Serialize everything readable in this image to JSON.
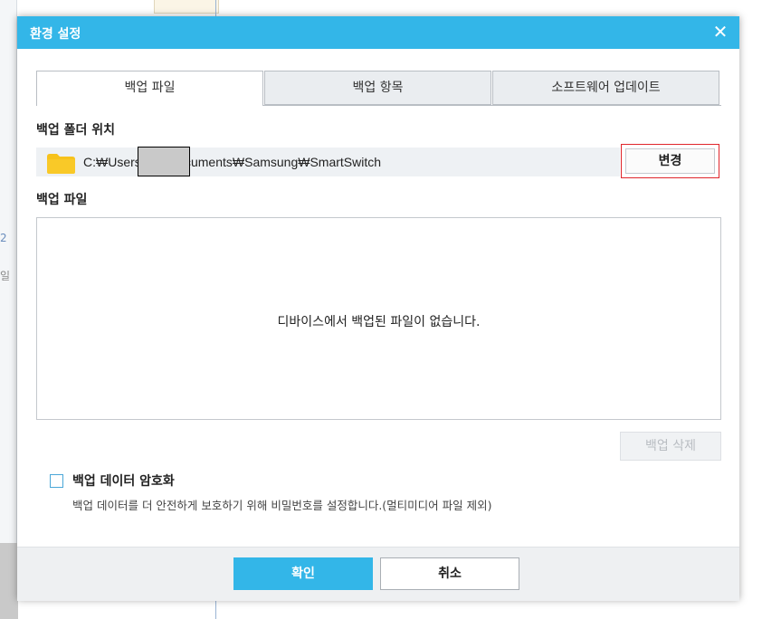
{
  "dialog": {
    "title": "환경 설정",
    "close_glyph": "✕"
  },
  "tabs": [
    {
      "label": "백업 파일",
      "active": true
    },
    {
      "label": "백업 항목",
      "active": false
    },
    {
      "label": "소프트웨어 업데이트",
      "active": false
    }
  ],
  "backup_folder": {
    "label": "백업 폴더 위치",
    "path": "C:₩Users₩          ₩Documents₩Samsung₩SmartSwitch",
    "change_button": "변경",
    "icon": "folder-icon"
  },
  "backup_files": {
    "label": "백업 파일",
    "empty_message": "디바이스에서 백업된 파일이 없습니다.",
    "delete_button": "백업 삭제"
  },
  "encryption": {
    "label": "백업 데이터 암호화",
    "description": "백업 데이터를 더 안전하게 보호하기 위해 비밀번호를 설정합니다.(멀티미디어 파일 제외)",
    "checked": false
  },
  "footer": {
    "ok_button": "확인",
    "cancel_button": "취소"
  },
  "background": {
    "num_fragment": "2",
    "text_fragment": "일"
  },
  "colors": {
    "accent": "#33b6e8",
    "highlight_border": "#e0262c",
    "folder": "#f7c21b"
  }
}
